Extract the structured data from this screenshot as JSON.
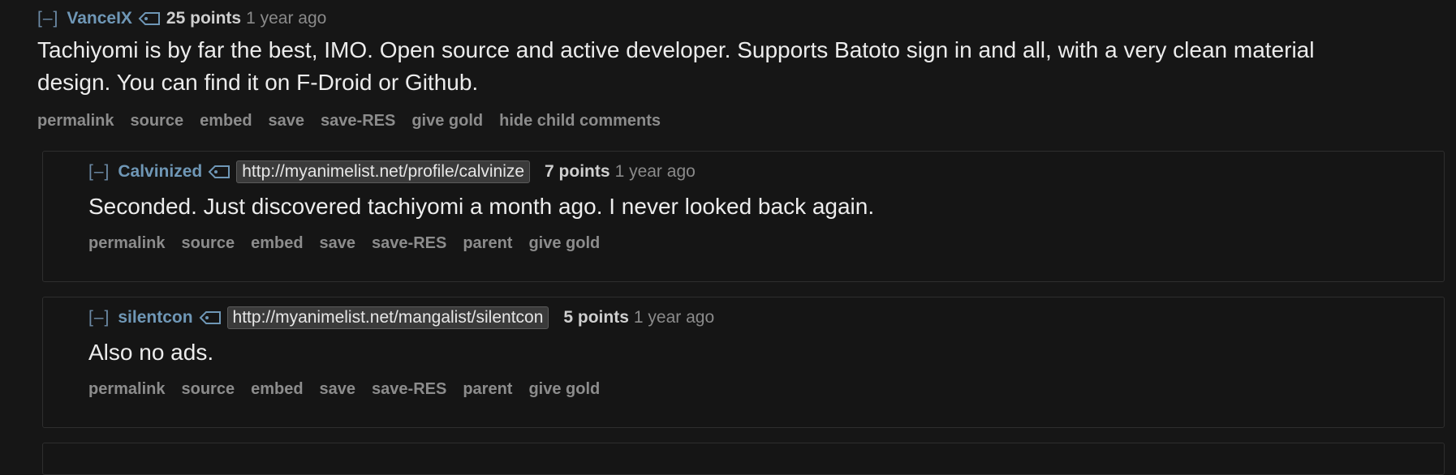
{
  "top_comment": {
    "expand": "[–]",
    "author": "VanceIX",
    "score": "25 points",
    "time": "1 year ago",
    "body": "Tachiyomi is by far the best, IMO. Open source and active developer. Supports Batoto sign in and all, with a very clean material design. You can find it on F-Droid or Github.",
    "buttons": [
      "permalink",
      "source",
      "embed",
      "save",
      "save-RES",
      "give gold",
      "hide child comments"
    ]
  },
  "replies": [
    {
      "expand": "[–]",
      "author": "Calvinized",
      "flair": "http://myanimelist.net/profile/calvinize",
      "score": "7 points",
      "time": "1 year ago",
      "body": "Seconded. Just discovered tachiyomi a month ago. I never looked back again.",
      "buttons": [
        "permalink",
        "source",
        "embed",
        "save",
        "save-RES",
        "parent",
        "give gold"
      ]
    },
    {
      "expand": "[–]",
      "author": "silentcon",
      "flair": "http://myanimelist.net/mangalist/silentcon",
      "score": "5 points",
      "time": "1 year ago",
      "body": "Also no ads.",
      "buttons": [
        "permalink",
        "source",
        "embed",
        "save",
        "save-RES",
        "parent",
        "give gold"
      ]
    }
  ],
  "colors": {
    "background": "#161616",
    "author": "#6f97b6",
    "button": "#8c8c8c"
  }
}
